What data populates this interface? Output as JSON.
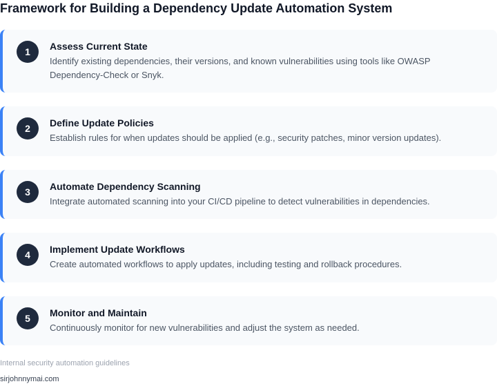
{
  "title": "Framework for Building a Dependency Update Automation System",
  "steps": [
    {
      "number": "1",
      "title": "Assess Current State",
      "description": "Identify existing dependencies, their versions, and known vulnerabilities using tools like OWASP Dependency-Check or Snyk."
    },
    {
      "number": "2",
      "title": "Define Update Policies",
      "description": "Establish rules for when updates should be applied (e.g., security patches, minor version updates)."
    },
    {
      "number": "3",
      "title": "Automate Dependency Scanning",
      "description": "Integrate automated scanning into your CI/CD pipeline to detect vulnerabilities in dependencies."
    },
    {
      "number": "4",
      "title": "Implement Update Workflows",
      "description": "Create automated workflows to apply updates, including testing and rollback procedures."
    },
    {
      "number": "5",
      "title": "Monitor and Maintain",
      "description": "Continuously monitor for new vulnerabilities and adjust the system as needed."
    }
  ],
  "footer": {
    "note": "Internal security automation guidelines",
    "credit": "sirjohnnymai.com"
  },
  "colors": {
    "accent": "#3b82f6",
    "badge": "#1f2a3d",
    "card_background": "#f8fafc"
  }
}
